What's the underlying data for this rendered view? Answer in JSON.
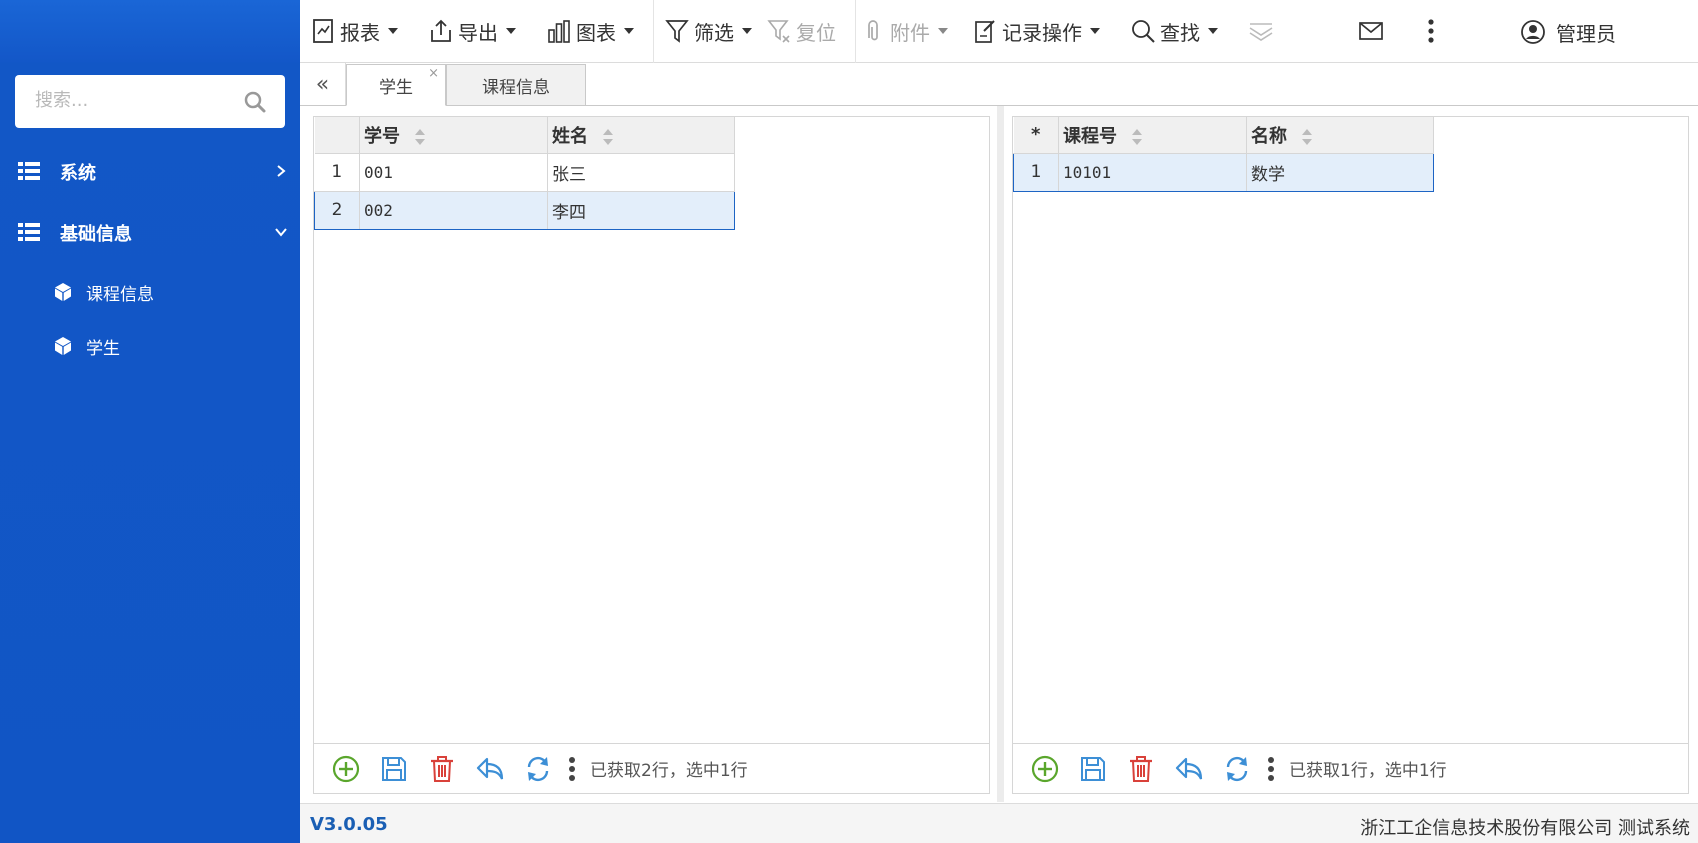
{
  "sidebar": {
    "search_placeholder": "搜索...",
    "menu": [
      {
        "label": "系统",
        "expanded": false
      },
      {
        "label": "基础信息",
        "expanded": true
      }
    ],
    "sub_items": [
      {
        "label": "课程信息"
      },
      {
        "label": "学生"
      }
    ],
    "bg_color": "#1257c6"
  },
  "toolbar": {
    "report": "报表",
    "export": "导出",
    "chart": "图表",
    "filter": "筛选",
    "reset": "复位",
    "attachment": "附件",
    "record_ops": "记录操作",
    "find": "查找",
    "user": "管理员"
  },
  "tabs": [
    {
      "label": "学生",
      "active": true,
      "close": "×"
    },
    {
      "label": "课程信息",
      "active": false
    }
  ],
  "collapse_icon": "«",
  "left_grid": {
    "columns": [
      "学号",
      "姓名"
    ],
    "rows": [
      {
        "n": "1",
        "id": "001",
        "name": "张三",
        "selected": false
      },
      {
        "n": "2",
        "id": "002",
        "name": "李四",
        "selected": true
      }
    ],
    "status": "已获取2行，选中1行"
  },
  "right_grid": {
    "corner": "*",
    "columns": [
      "课程号",
      "名称"
    ],
    "rows": [
      {
        "n": "1",
        "code": "10101",
        "name": "数学",
        "selected": true
      }
    ],
    "status": "已获取1行，选中1行"
  },
  "footer": {
    "version": "V3.0.05",
    "company": "浙江工企信息技术股份有限公司 测试系统"
  },
  "colors": {
    "accent": "#1d64c4",
    "add_green": "#5aa62c",
    "save_blue": "#3d8fd6",
    "delete_red": "#d9413a",
    "selected_row": "#e3eefa"
  }
}
